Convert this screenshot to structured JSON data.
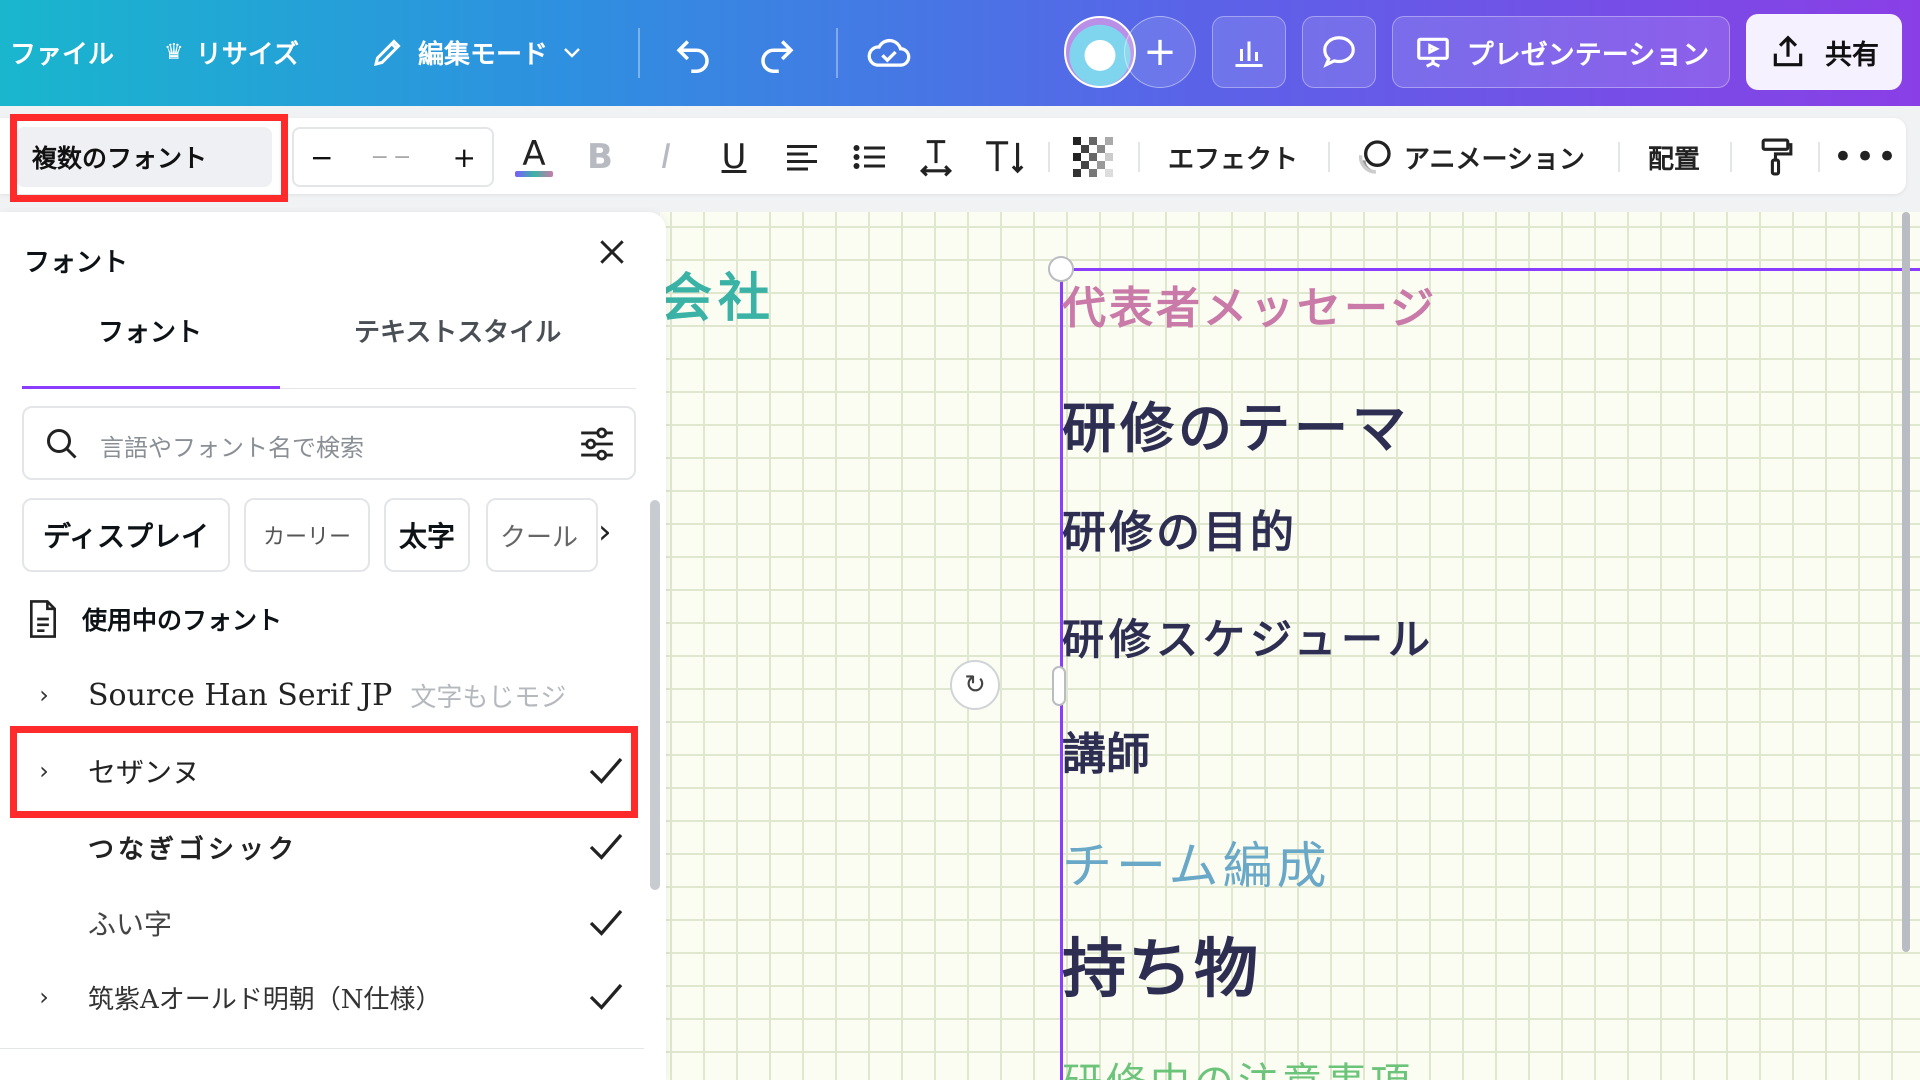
{
  "header": {
    "file": "ファイル",
    "resize": "リサイズ",
    "edit_mode": "編集モード",
    "present": "プレゼンテーション",
    "share": "共有"
  },
  "toolbar": {
    "font_name": "複数のフォント",
    "size_minus": "−",
    "size_value": "−−",
    "size_plus": "+",
    "effects": "エフェクト",
    "animation": "アニメーション",
    "position": "配置"
  },
  "panel": {
    "title": "フォント",
    "tabs": [
      {
        "label": "フォント"
      },
      {
        "label": "テキストスタイル"
      }
    ],
    "search_placeholder": "言語やフォント名で検索",
    "chips": [
      "ディスプレイ",
      "カーリー",
      "太字",
      "クール"
    ],
    "section_title": "使用中のフォント",
    "fonts": [
      {
        "name": "Source Han Serif JP",
        "sample": "文字もじモジ",
        "checked": false
      },
      {
        "name": "セザンヌ",
        "checked": true
      },
      {
        "name": "つなぎゴシック",
        "checked": true
      },
      {
        "name": "ふい字",
        "checked": true
      },
      {
        "name": "筑紫Aオールド明朝（N仕様）",
        "checked": true
      }
    ]
  },
  "canvas": {
    "company_fragment": "会社",
    "lines": [
      {
        "text": "代表者メッセージ",
        "color": "#c97aa8"
      },
      {
        "text": "研修のテーマ",
        "color": "#2e2e52"
      },
      {
        "text": "研修の目的",
        "color": "#2e2e52"
      },
      {
        "text": "研修スケジュール",
        "color": "#2e2e52"
      },
      {
        "text": "講師",
        "color": "#2e2e52"
      },
      {
        "text": "チーム編成",
        "color": "#6aa8c8"
      },
      {
        "text": "持ち物",
        "color": "#2e2e52"
      },
      {
        "text": "研修中の注意事項",
        "color": "#6cc47a"
      }
    ]
  },
  "colors": {
    "accent": "#8b3dff",
    "highlight": "#ff2a2a"
  }
}
